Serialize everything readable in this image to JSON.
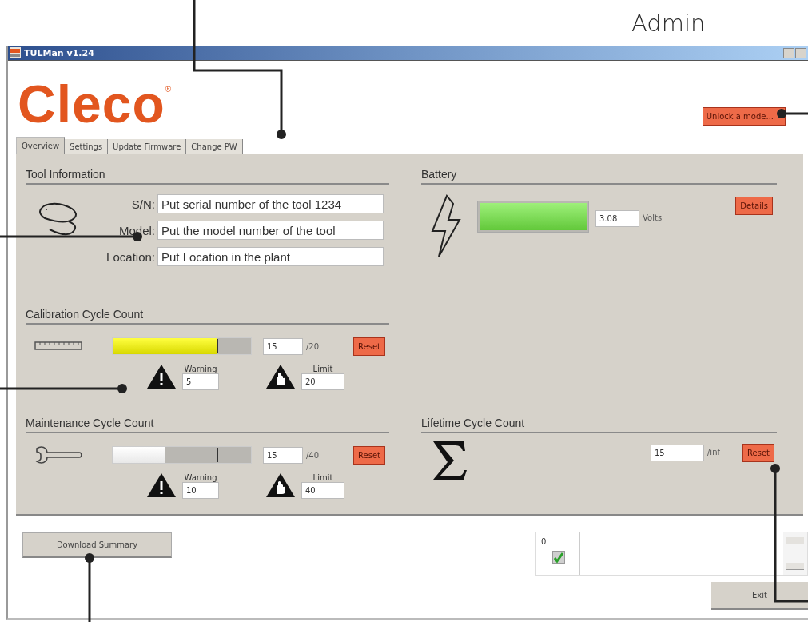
{
  "annotation": {
    "label": "Admin"
  },
  "window": {
    "title": "TULMan v1.24"
  },
  "logo": {
    "text": "Cleco",
    "mark": "®"
  },
  "unlock_button": "Unlock a mode...",
  "tabs": [
    {
      "label": "Overview",
      "selected": true
    },
    {
      "label": "Settings",
      "selected": false
    },
    {
      "label": "Update Firmware",
      "selected": false
    },
    {
      "label": "Change PW",
      "selected": false
    }
  ],
  "tool_information": {
    "title": "Tool Information",
    "fields": [
      {
        "label": "S/N:",
        "value": "Put serial number of the tool 1234"
      },
      {
        "label": "Model:",
        "value": "Put the model number of the tool"
      },
      {
        "label": "Location:",
        "value": "Put Location in the plant"
      }
    ]
  },
  "counters": [
    {
      "kind": "calibration",
      "title": "Calibration Cycle Count",
      "level": 0.75,
      "count": "15",
      "max": "/20",
      "reset": "Reset",
      "warning_label": "Warning",
      "warning": "5",
      "limit_label": "Limit",
      "limit": "20"
    },
    {
      "kind": "maintenance",
      "title": "Maintenance Cycle Count",
      "level": 0.375,
      "count": "15",
      "max": "/40",
      "reset": "Reset",
      "warning_label": "Warning",
      "warning": "10",
      "limit_label": "Limit",
      "limit": "40"
    }
  ],
  "battery": {
    "title": "Battery",
    "level": 1,
    "voltage": "3.08",
    "unit": "Volts",
    "details": "Details"
  },
  "lifetime": {
    "title": "Lifetime Cycle Count",
    "count": "15",
    "max": "/inf",
    "reset": "Reset"
  },
  "download_button": "Download Summary",
  "status_list": {
    "items": [
      {
        "count": "0",
        "checked": true
      }
    ]
  },
  "exit_button": "Exit"
}
